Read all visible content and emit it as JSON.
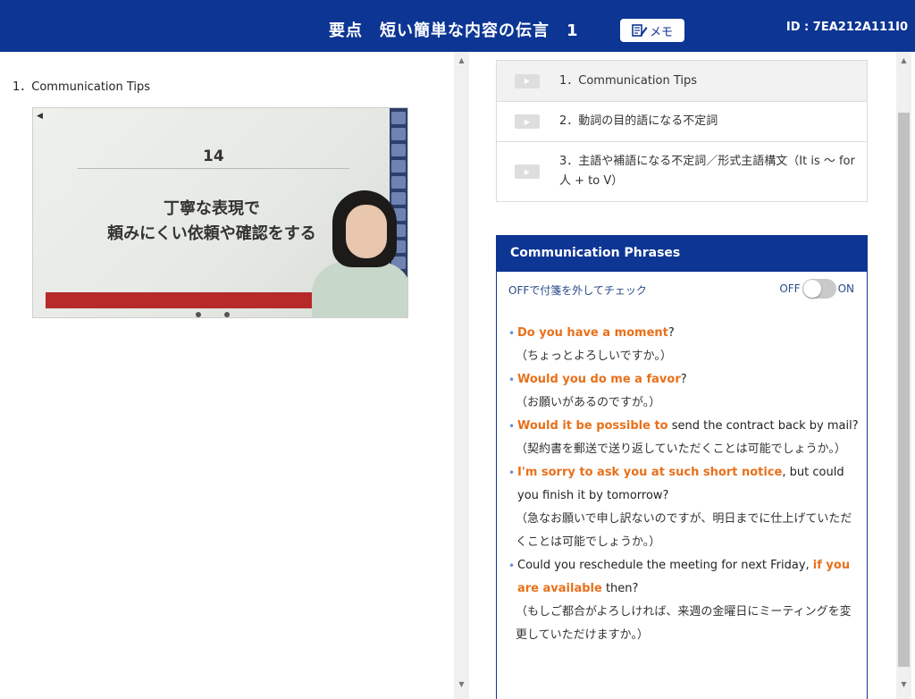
{
  "header": {
    "title": "要点　短い簡単な内容の伝言　1",
    "memo_label": "メモ",
    "memo_icon": "pencil-note-icon",
    "id_text": "ID : 7EA212A111I0",
    "bg_color": "#0d3593"
  },
  "left": {
    "section_title": "1．Communication Tips",
    "video": {
      "slide_number": "14",
      "slide_line1": "丁寧な表現で",
      "slide_line2": "頼みにくい依頼や確認をする"
    }
  },
  "lessons": [
    {
      "label": "1．Communication Tips",
      "active": true
    },
    {
      "label": "2．動詞の目的語になる不定詞",
      "active": false
    },
    {
      "label": "3．主語や補語になる不定詞／形式主語構文（It is ～ for 人 + to V）",
      "active": false
    }
  ],
  "phrases_panel": {
    "title": "Communication Phrases",
    "hint": "OFFで付箋を外してチェック",
    "toggle_off": "OFF",
    "toggle_on": "ON",
    "accent_color": "#e8701a"
  },
  "phrases": [
    {
      "en": [
        {
          "t": "Do you have a moment",
          "hl": true
        },
        {
          "t": "?",
          "hl": false
        }
      ],
      "ja": "（ちょっとよろしいですか。）"
    },
    {
      "en": [
        {
          "t": "Would you do me a favor",
          "hl": true
        },
        {
          "t": "?",
          "hl": false
        }
      ],
      "ja": "（お願いがあるのですが。）"
    },
    {
      "en": [
        {
          "t": "Would it be possible to",
          "hl": true
        },
        {
          "t": " send the contract back by mail?",
          "hl": false
        }
      ],
      "ja": "（契約書を郵送で送り返していただくことは可能でしょうか。）"
    },
    {
      "en": [
        {
          "t": "I'm sorry to ask you at such short notice",
          "hl": true
        },
        {
          "t": ", but could you finish it by tomorrow?",
          "hl": false
        }
      ],
      "ja": "（急なお願いで申し訳ないのですが、明日までに仕上げていただくことは可能でしょうか。）"
    },
    {
      "en": [
        {
          "t": "Could you reschedule the meeting for next Friday, ",
          "hl": false
        },
        {
          "t": "if you are available",
          "hl": true
        },
        {
          "t": " then?",
          "hl": false
        }
      ],
      "ja": "（もしご都合がよろしければ、来週の金曜日にミーティングを変更していただけますか。）"
    }
  ]
}
